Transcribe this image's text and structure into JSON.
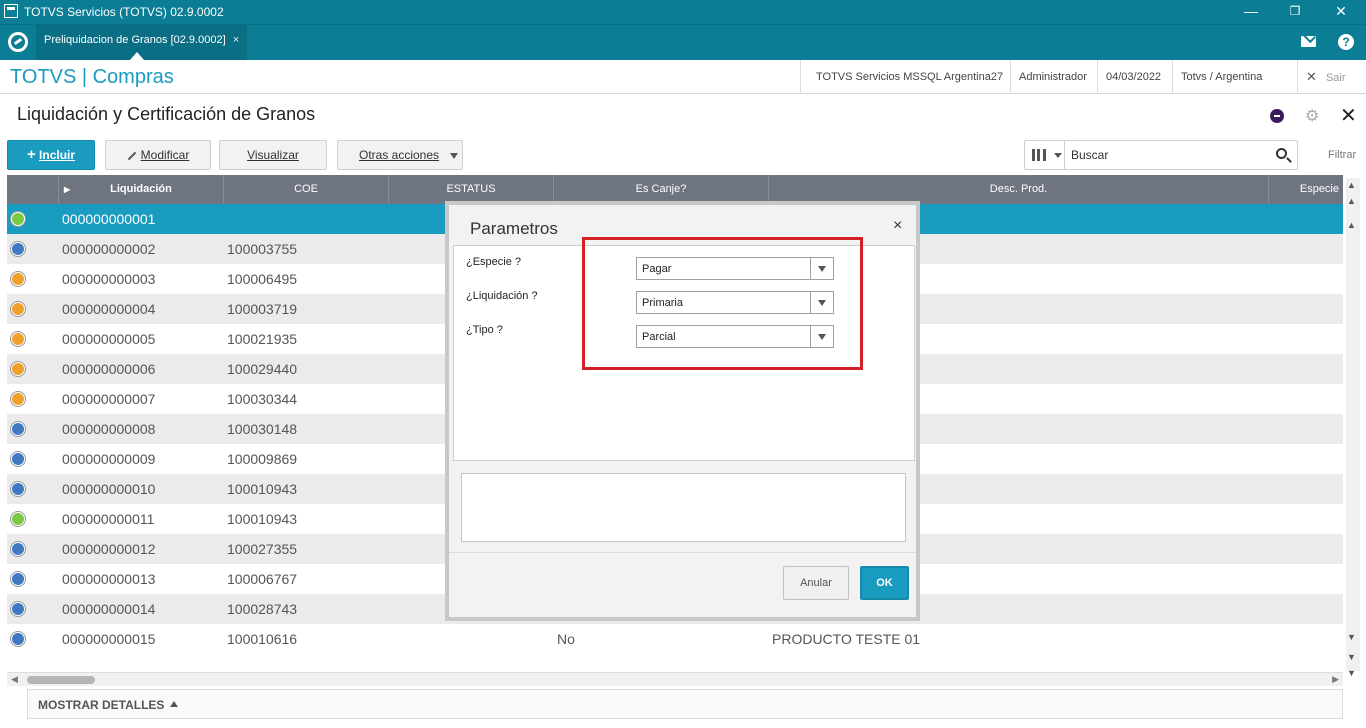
{
  "window": {
    "title": "TOTVS Servicios (TOTVS) 02.9.0002",
    "minimize": "—",
    "restore": "❐",
    "close": "✕"
  },
  "tabbar": {
    "tab_label": "Preliquidacion de Granos [02.9.0002]",
    "tab_close": "×",
    "help": "?"
  },
  "header": {
    "brand": "TOTVS | Compras",
    "server": "TOTVS Servicios MSSQL Argentina27",
    "user": "Administrador",
    "date": "04/03/2022",
    "company": "Totvs / Argentina",
    "exit_icon": "✕",
    "exit": "Sair"
  },
  "page": {
    "title": "Liquidación y Certificación de Granos",
    "close": "✕"
  },
  "toolbar": {
    "incluir": "Incluir",
    "modificar": "Modificar",
    "visualizar": "Visualizar",
    "otras": "Otras acciones",
    "search_value": "Buscar",
    "filtrar": "Filtrar"
  },
  "grid": {
    "columns": [
      "Liquidación",
      "COE",
      "ESTATUS",
      "Es Canje?",
      "Desc. Prod.",
      "Especie"
    ],
    "rows": [
      {
        "status": "green",
        "liq": "000000000001",
        "coe": "",
        "canje": "",
        "desc": ""
      },
      {
        "status": "blue",
        "liq": "000000000002",
        "coe": "100003755",
        "canje": "",
        "desc": ""
      },
      {
        "status": "orange",
        "liq": "000000000003",
        "coe": "100006495",
        "canje": "",
        "desc": ""
      },
      {
        "status": "orange",
        "liq": "000000000004",
        "coe": "100003719",
        "canje": "",
        "desc": ""
      },
      {
        "status": "orange",
        "liq": "000000000005",
        "coe": "100021935",
        "canje": "",
        "desc": ""
      },
      {
        "status": "orange",
        "liq": "000000000006",
        "coe": "100029440",
        "canje": "",
        "desc": ""
      },
      {
        "status": "orange",
        "liq": "000000000007",
        "coe": "100030344",
        "canje": "",
        "desc": ""
      },
      {
        "status": "blue",
        "liq": "000000000008",
        "coe": "100030148",
        "canje": "",
        "desc": ""
      },
      {
        "status": "blue",
        "liq": "000000000009",
        "coe": "100009869",
        "canje": "",
        "desc": ""
      },
      {
        "status": "blue",
        "liq": "000000000010",
        "coe": "100010943",
        "canje": "",
        "desc": ""
      },
      {
        "status": "green",
        "liq": "000000000011",
        "coe": "100010943",
        "canje": "",
        "desc": ""
      },
      {
        "status": "blue",
        "liq": "000000000012",
        "coe": "100027355",
        "canje": "",
        "desc": ""
      },
      {
        "status": "blue",
        "liq": "000000000013",
        "coe": "100006767",
        "canje": "",
        "desc": ""
      },
      {
        "status": "blue",
        "liq": "000000000014",
        "coe": "100028743",
        "canje": "",
        "desc": ""
      },
      {
        "status": "blue",
        "liq": "000000000015",
        "coe": "100010616",
        "canje": "No",
        "desc": "PRODUCTO TESTE 01"
      }
    ],
    "status_colors": {
      "green": "#7ac943",
      "blue": "#3f79c2",
      "orange": "#f0a12b"
    }
  },
  "footer": {
    "details": "MOSTRAR DETALLES"
  },
  "modal": {
    "title": "Parametros",
    "close": "×",
    "params": [
      {
        "label": "¿Especie ?",
        "value": "Pagar"
      },
      {
        "label": "¿Liquidación ?",
        "value": "Primaria"
      },
      {
        "label": "¿Tipo ?",
        "value": "Parcial"
      }
    ],
    "cancel": "Anular",
    "ok": "OK"
  },
  "colors": {
    "accent": "#1a9bc0",
    "titlebar": "#0b7e95",
    "grid_header": "#6e7480",
    "highlight_box": "#d41f26"
  }
}
